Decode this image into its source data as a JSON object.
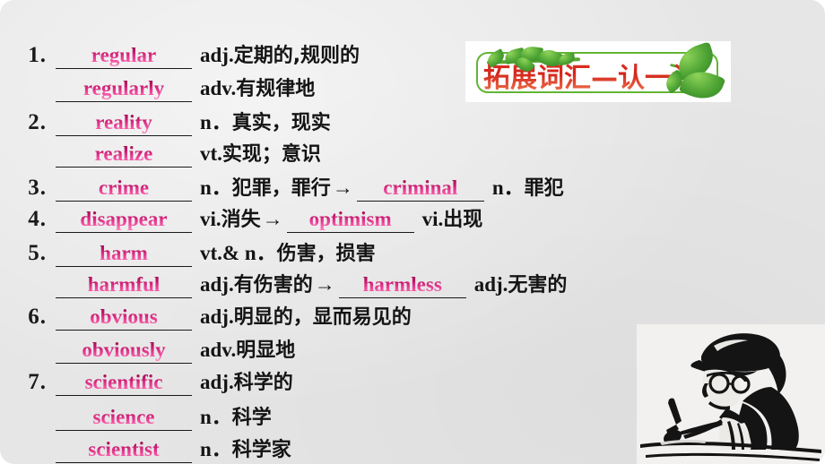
{
  "slide": {
    "background_color": "#e6e6e6",
    "banner": {
      "title": "拓展词汇—认一认",
      "border_color": "#63b534",
      "text_color": "#d4241a",
      "leaf_color": "#4da333"
    },
    "sketch": {
      "alt": "black and white sketch of a student wearing a hat and glasses writing at a desk"
    }
  },
  "answer_color": "#c8186e",
  "entries": [
    {
      "number": "1.",
      "lines": [
        {
          "answer": "regular",
          "pos": "adj.",
          "meaning": "定期的,规则的"
        },
        {
          "answer": "regularly",
          "pos": "adv.",
          "meaning": "有规律地"
        }
      ]
    },
    {
      "number": "2.",
      "lines": [
        {
          "answer": "reality",
          "pos": "n．",
          "meaning": "真实，现实"
        },
        {
          "answer": "realize",
          "pos": "vt.",
          "meaning": "实现；意识"
        }
      ]
    },
    {
      "number": "3.",
      "lines": [
        {
          "answer": "crime",
          "pos": "n．",
          "meaning": "犯罪，罪行",
          "arrow": "→",
          "answer2": "criminal",
          "pos2": "n．",
          "meaning2": "罪犯"
        }
      ]
    },
    {
      "number": "4.",
      "lines": [
        {
          "answer": "disappear",
          "pos": "vi.",
          "meaning": "消失",
          "arrow": "→",
          "answer2": "optimism",
          "pos2": "vi.",
          "meaning2": "出现"
        }
      ]
    },
    {
      "number": "5.",
      "lines": [
        {
          "answer": "harm",
          "pos": "vt.& n．",
          "meaning": "伤害，损害"
        },
        {
          "answer": "harmful",
          "pos": "adj.",
          "meaning": "有伤害的",
          "arrow": "→",
          "answer2": "harmless",
          "pos2": "adj.",
          "meaning2": "无害的"
        }
      ]
    },
    {
      "number": "6.",
      "lines": [
        {
          "answer": "obvious",
          "pos": "adj.",
          "meaning": "明显的，显而易见的"
        },
        {
          "answer": "obviously",
          "pos": "adv.",
          "meaning": "明显地"
        }
      ]
    },
    {
      "number": "7.",
      "lines": [
        {
          "answer": "scientific",
          "pos": "adj.",
          "meaning": "科学的"
        },
        {
          "answer": "science",
          "pos": "n．",
          "meaning": "科学"
        },
        {
          "answer": "scientist",
          "pos": "n．",
          "meaning": "科学家"
        }
      ]
    }
  ]
}
